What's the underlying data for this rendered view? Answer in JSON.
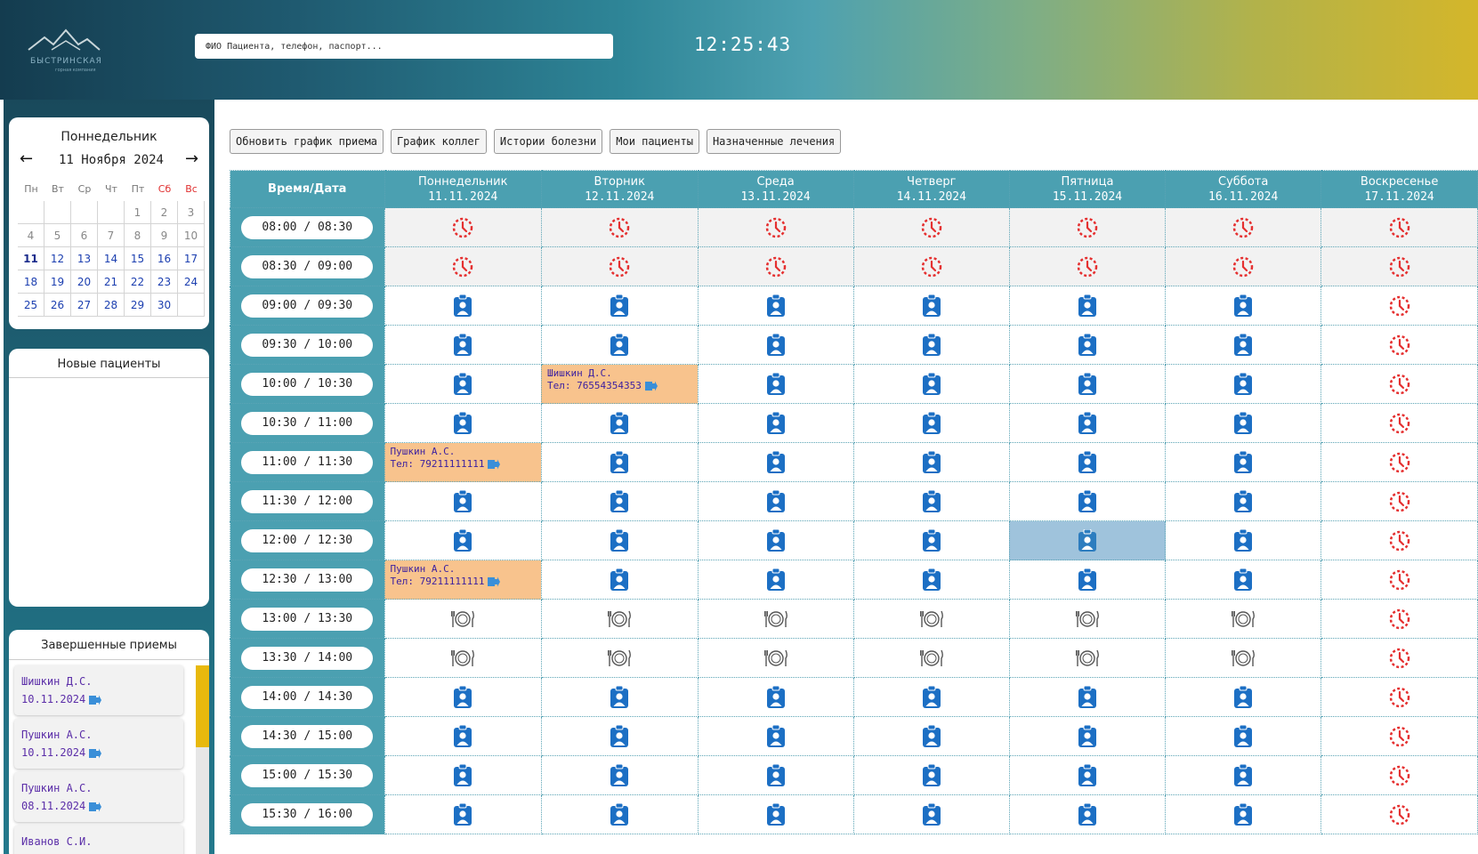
{
  "header": {
    "logo_title": "БЫСТРИНСКАЯ",
    "logo_subtitle": "горная компания",
    "search_placeholder": "ФИО Пациента, телефон, паспорт...",
    "clock": "12:25:43"
  },
  "calendar": {
    "weekday": "Поннедельник",
    "month_label": "11 Ноября 2024",
    "prev": "←",
    "next": "→",
    "dow": [
      "Пн",
      "Вт",
      "Ср",
      "Чт",
      "Пт",
      "Сб",
      "Вс"
    ],
    "weeks": [
      [
        "",
        "",
        "",
        "",
        "1",
        "2",
        "3"
      ],
      [
        "4",
        "5",
        "6",
        "7",
        "8",
        "9",
        "10"
      ],
      [
        "11",
        "12",
        "13",
        "14",
        "15",
        "16",
        "17"
      ],
      [
        "18",
        "19",
        "20",
        "21",
        "22",
        "23",
        "24"
      ],
      [
        "25",
        "26",
        "27",
        "28",
        "29",
        "30",
        ""
      ]
    ]
  },
  "new_patients": {
    "title": "Новые пациенты"
  },
  "completed": {
    "title": "Завершенные приемы",
    "items": [
      {
        "name": "Шишкин Д.С.",
        "date": "10.11.2024"
      },
      {
        "name": "Пушкин А.С.",
        "date": "10.11.2024"
      },
      {
        "name": "Пушкин А.С.",
        "date": "08.11.2024"
      },
      {
        "name": "Иванов С.И.",
        "date": ""
      }
    ]
  },
  "toolbar": {
    "refresh": "Обновить график приема",
    "colleagues": "График коллег",
    "histories": "Истории болезни",
    "my_patients": "Мои пациенты",
    "treatments": "Назначенные лечения"
  },
  "schedule": {
    "corner": "Время/Дата",
    "days": [
      {
        "name": "Поннедельник",
        "date": "11.11.2024"
      },
      {
        "name": "Вторник",
        "date": "12.11.2024"
      },
      {
        "name": "Среда",
        "date": "13.11.2024"
      },
      {
        "name": "Четверг",
        "date": "14.11.2024"
      },
      {
        "name": "Пятница",
        "date": "15.11.2024"
      },
      {
        "name": "Суббота",
        "date": "16.11.2024"
      },
      {
        "name": "Воскресенье",
        "date": "17.11.2024"
      }
    ],
    "slots": [
      "08:00 / 08:30",
      "08:30 / 09:00",
      "09:00 / 09:30",
      "09:30 / 10:00",
      "10:00 / 10:30",
      "10:30 / 11:00",
      "11:00 / 11:30",
      "11:30 / 12:00",
      "12:00 / 12:30",
      "12:30 / 13:00",
      "13:00 / 13:30",
      "13:30 / 14:00",
      "14:00 / 14:30",
      "14:30 / 15:00",
      "15:00 / 15:30",
      "15:30 / 16:00"
    ],
    "cells": [
      [
        "clock",
        "clock",
        "clock",
        "clock",
        "clock",
        "clock",
        "clock"
      ],
      [
        "clock",
        "clock",
        "clock",
        "clock",
        "clock",
        "clock",
        "clock"
      ],
      [
        "badge",
        "badge",
        "badge",
        "badge",
        "badge",
        "badge",
        "clock"
      ],
      [
        "badge",
        "badge",
        "badge",
        "badge",
        "badge",
        "badge",
        "clock"
      ],
      [
        "badge",
        "booked:0",
        "badge",
        "badge",
        "badge",
        "badge",
        "clock"
      ],
      [
        "badge",
        "badge",
        "badge",
        "badge",
        "badge",
        "badge",
        "clock"
      ],
      [
        "booked:1",
        "badge",
        "badge",
        "badge",
        "badge",
        "badge",
        "clock"
      ],
      [
        "badge",
        "badge",
        "badge",
        "badge",
        "badge",
        "badge",
        "clock"
      ],
      [
        "badge",
        "badge",
        "badge",
        "badge",
        "badge-selected",
        "badge",
        "clock"
      ],
      [
        "booked:2",
        "badge",
        "badge",
        "badge",
        "badge",
        "badge",
        "clock"
      ],
      [
        "lunch",
        "lunch",
        "lunch",
        "lunch",
        "lunch",
        "lunch",
        "clock"
      ],
      [
        "lunch",
        "lunch",
        "lunch",
        "lunch",
        "lunch",
        "lunch",
        "clock"
      ],
      [
        "badge",
        "badge",
        "badge",
        "badge",
        "badge",
        "badge",
        "clock"
      ],
      [
        "badge",
        "badge",
        "badge",
        "badge",
        "badge",
        "badge",
        "clock"
      ],
      [
        "badge",
        "badge",
        "badge",
        "badge",
        "badge",
        "badge",
        "clock"
      ],
      [
        "badge",
        "badge",
        "badge",
        "badge",
        "badge",
        "badge",
        "clock"
      ]
    ],
    "bookings": [
      {
        "name": "Шишкин Д.С.",
        "phone": "Тел: 76554354353"
      },
      {
        "name": "Пушкин А.С.",
        "phone": "Тел: 79211111111"
      },
      {
        "name": "Пушкин А.С.",
        "phone": "Тел: 79211111111"
      }
    ],
    "icons": {
      "clock": "clock-unavailable-icon",
      "badge": "patient-badge-icon",
      "lunch": "lunch-plate-icon",
      "exit": "open-record-icon"
    },
    "colors": {
      "header": "#4ba0b1",
      "booked": "#f8c38d",
      "selected": "#9fc3dc",
      "badge": "#1c6fc4",
      "clock": "#e53030"
    }
  }
}
